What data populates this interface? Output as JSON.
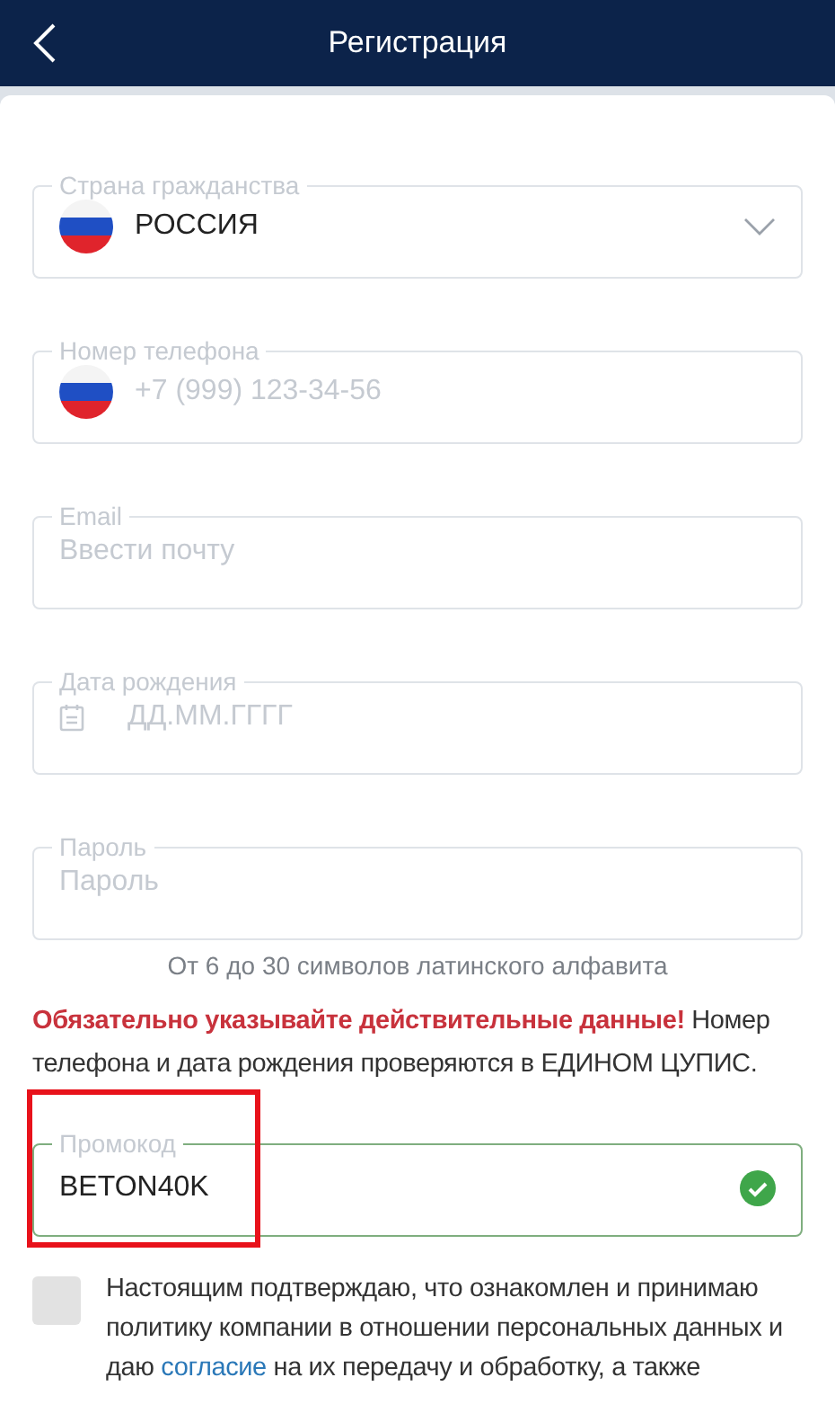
{
  "header": {
    "title": "Регистрация"
  },
  "fields": [
    {
      "kind": "select",
      "label": "Страна гражданства",
      "value": "РОССИЯ"
    },
    {
      "kind": "phone",
      "label": "Номер телефона",
      "placeholder": "+7 (999) 123-34-56"
    },
    {
      "kind": "text",
      "label": "Email",
      "placeholder": "Ввести почту"
    },
    {
      "kind": "date",
      "label": "Дата рождения",
      "placeholder": "ДД.ММ.ГГГГ"
    },
    {
      "kind": "text",
      "label": "Пароль",
      "placeholder": "Пароль",
      "hint": "От 6 до 30 символов латинского алфавита"
    }
  ],
  "warning": "**Обязательно указывайте действительные данные!** Номер телефона и дата рождения проверяются в ЕДИНОМ ЦУПИС.",
  "promo": {
    "label": "Промокод",
    "value": "BETON40K",
    "valid": true,
    "highlighted": true
  },
  "consent": {
    "checked": false,
    "text_before": "Настоящим подтверждаю, что ознакомлен и принимаю политику компании в отношении персональных данных и даю ",
    "link": "согласие",
    "text_after": " на их передачу и обработку, а также"
  }
}
